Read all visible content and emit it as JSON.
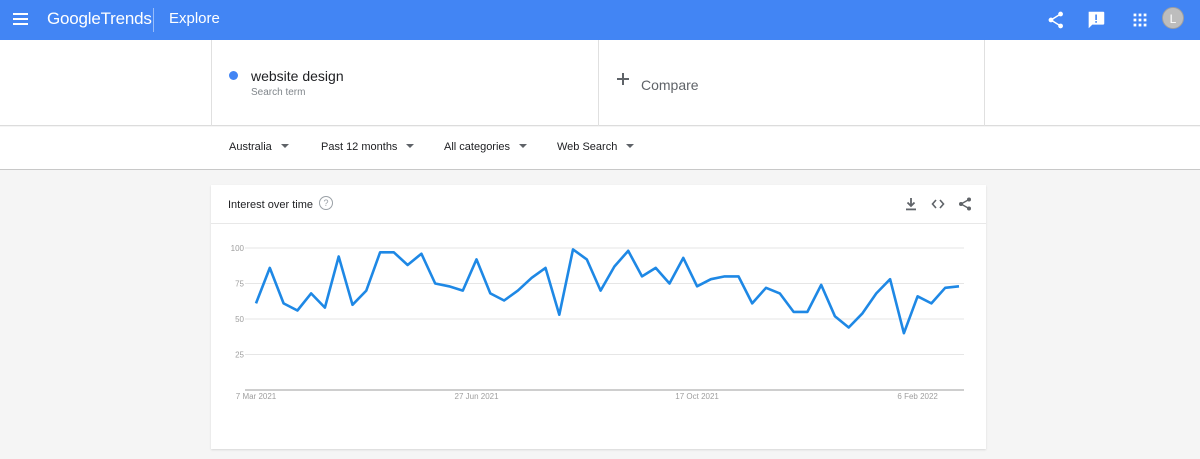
{
  "header": {
    "brand_google": "Google",
    "brand_trends": "Trends",
    "section": "Explore",
    "avatar_initial": "L",
    "icons": [
      "menu-icon",
      "share-icon",
      "feedback-icon",
      "apps-icon"
    ]
  },
  "search": {
    "term": "website design",
    "term_type": "Search term",
    "term_color": "#4285f4",
    "compare_label": "Compare"
  },
  "filters": {
    "region": "Australia",
    "time_range": "Past 12 months",
    "category": "All categories",
    "search_type": "Web Search"
  },
  "card": {
    "title": "Interest over time",
    "help": "?",
    "actions": [
      "download-icon",
      "embed-icon",
      "share-icon"
    ]
  },
  "chart_data": {
    "type": "line",
    "title": "Interest over time",
    "ylim": [
      0,
      100
    ],
    "yticks": [
      25,
      50,
      75,
      100
    ],
    "ytick_labels": [
      "25",
      "50",
      "75",
      "100"
    ],
    "xtick_labels": [
      "7 Mar 2021",
      "27 Jun 2021",
      "17 Oct 2021",
      "6 Feb 2022"
    ],
    "grid": true,
    "series": [
      {
        "color": "#1e88e5",
        "values": [
          61,
          86,
          61,
          56,
          68,
          58,
          94,
          60,
          70,
          97,
          97,
          88,
          96,
          75,
          73,
          70,
          92,
          68,
          63,
          70,
          79,
          86,
          53,
          99,
          92,
          70,
          87,
          98,
          80,
          86,
          75,
          93,
          73,
          78,
          80,
          80,
          61,
          72,
          68,
          55,
          55,
          74,
          52,
          44,
          54,
          68,
          78,
          40,
          66,
          61,
          72,
          73
        ]
      }
    ]
  }
}
